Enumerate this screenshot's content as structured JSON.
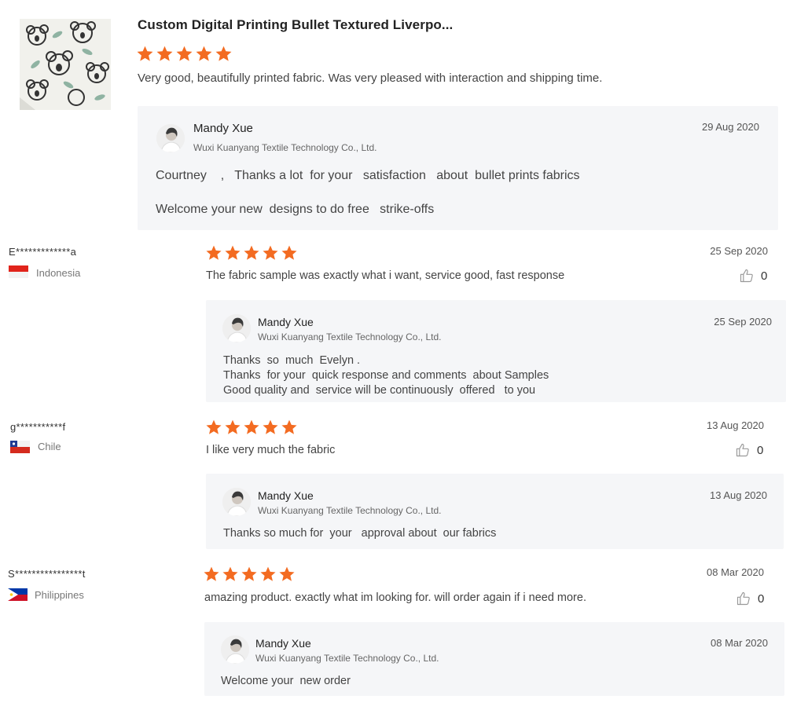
{
  "colors": {
    "star": "#f36b21",
    "reply_bg": "#f5f6f8"
  },
  "product": {
    "title": "Custom Digital Printing Bullet Textured Liverpo...",
    "rating": 5,
    "review_text": "Very good, beautifully printed fabric. Was very pleased with interaction and shipping time.",
    "reply": {
      "name": "Mandy Xue",
      "company": "Wuxi Kuanyang Textile Technology Co., Ltd.",
      "date": "29 Aug 2020",
      "lines": [
        "Courtney    ,   Thanks a lot  for your   satisfaction   about  bullet prints fabrics",
        "Welcome your new  designs to do free   strike-offs"
      ]
    }
  },
  "reviews": [
    {
      "reviewer": "E*************a",
      "country": "Indonesia",
      "flag_icon": "indonesia-flag-icon",
      "rating": 5,
      "date": "25 Sep 2020",
      "text": "The fabric sample was exactly what i want, service good, fast response",
      "likes": "0",
      "reply": {
        "name": "Mandy Xue",
        "company": "Wuxi Kuanyang Textile Technology Co., Ltd.",
        "date": "25 Sep 2020",
        "lines": [
          "Thanks  so  much  Evelyn .",
          "Thanks  for your  quick response and comments  about Samples",
          "Good quality and  service will be continuously  offered   to you"
        ]
      }
    },
    {
      "reviewer": "g***********f",
      "country": "Chile",
      "flag_icon": "chile-flag-icon",
      "rating": 5,
      "date": "13 Aug 2020",
      "text": "I like very much the fabric",
      "likes": "0",
      "reply": {
        "name": "Mandy Xue",
        "company": "Wuxi Kuanyang Textile Technology Co., Ltd.",
        "date": "13 Aug 2020",
        "lines": [
          "Thanks so much for  your   approval about  our fabrics"
        ]
      }
    },
    {
      "reviewer": "S****************t",
      "country": "Philippines",
      "flag_icon": "philippines-flag-icon",
      "rating": 5,
      "date": "08 Mar 2020",
      "text": "amazing product. exactly what im looking for. will order again if i need more.",
      "likes": "0",
      "reply": {
        "name": "Mandy Xue",
        "company": "Wuxi Kuanyang Textile Technology Co., Ltd.",
        "date": "08 Mar 2020",
        "lines": [
          "Welcome your  new order"
        ]
      }
    }
  ]
}
